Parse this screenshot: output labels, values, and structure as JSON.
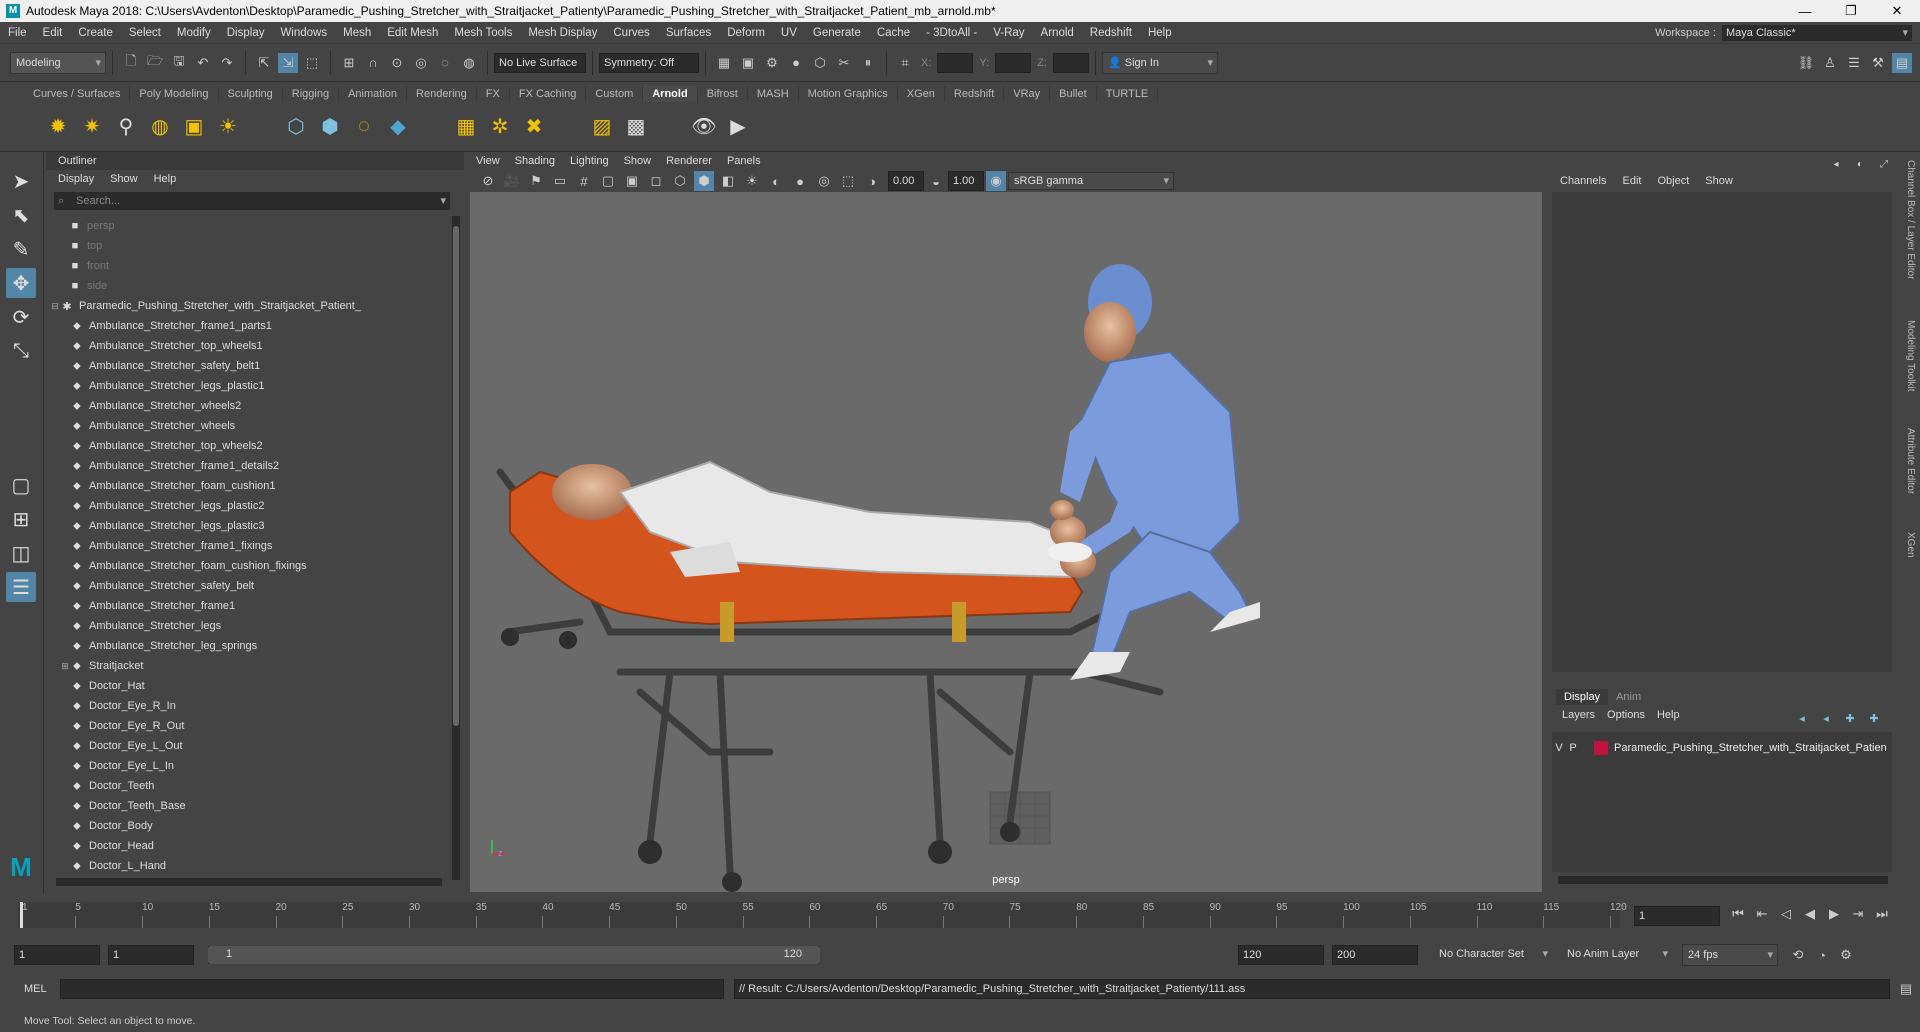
{
  "window": {
    "title": "Autodesk Maya 2018: C:\\Users\\Avdenton\\Desktop\\Paramedic_Pushing_Stretcher_with_Straitjacket_Patienty\\Paramedic_Pushing_Stretcher_with_Straitjacket_Patient_mb_arnold.mb*",
    "logo": "M"
  },
  "menubar": [
    "File",
    "Edit",
    "Create",
    "Select",
    "Modify",
    "Display",
    "Windows",
    "Mesh",
    "Edit Mesh",
    "Mesh Tools",
    "Mesh Display",
    "Curves",
    "Surfaces",
    "Deform",
    "UV",
    "Generate",
    "Cache",
    "- 3DtoAll -",
    "V-Ray",
    "Arnold",
    "Redshift",
    "Help"
  ],
  "workspace": {
    "label": "Workspace :",
    "value": "Maya Classic*"
  },
  "statusline": {
    "mode": "Modeling",
    "live_surface": "No Live Surface",
    "symmetry": "Symmetry: Off",
    "x_label": "X:",
    "y_label": "Y:",
    "z_label": "Z:",
    "sign_in": "Sign In"
  },
  "shelf_tabs": [
    "Curves / Surfaces",
    "Poly Modeling",
    "Sculpting",
    "Rigging",
    "Animation",
    "Rendering",
    "FX",
    "FX Caching",
    "Custom",
    "Arnold",
    "Bifrost",
    "MASH",
    "Motion Graphics",
    "XGen",
    "Redshift",
    "VRay",
    "Bullet",
    "TURTLE"
  ],
  "shelf_active": "Arnold",
  "outliner": {
    "title": "Outliner",
    "menu": [
      "Display",
      "Show",
      "Help"
    ],
    "search_placeholder": "Search...",
    "cameras": [
      "persp",
      "top",
      "front",
      "side"
    ],
    "group": "Paramedic_Pushing_Stretcher_with_Straitjacket_Patient_",
    "children": [
      "Ambulance_Stretcher_frame1_parts1",
      "Ambulance_Stretcher_top_wheels1",
      "Ambulance_Stretcher_safety_belt1",
      "Ambulance_Stretcher_legs_plastic1",
      "Ambulance_Stretcher_wheels2",
      "Ambulance_Stretcher_wheels",
      "Ambulance_Stretcher_top_wheels2",
      "Ambulance_Stretcher_frame1_details2",
      "Ambulance_Stretcher_foam_cushion1",
      "Ambulance_Stretcher_legs_plastic2",
      "Ambulance_Stretcher_legs_plastic3",
      "Ambulance_Stretcher_frame1_fixings",
      "Ambulance_Stretcher_foam_cushion_fixings",
      "Ambulance_Stretcher_safety_belt",
      "Ambulance_Stretcher_frame1",
      "Ambulance_Stretcher_legs",
      "Ambulance_Stretcher_leg_springs",
      "Straitjacket",
      "Doctor_Hat",
      "Doctor_Eye_R_In",
      "Doctor_Eye_R_Out",
      "Doctor_Eye_L_Out",
      "Doctor_Eye_L_In",
      "Doctor_Teeth",
      "Doctor_Teeth_Base",
      "Doctor_Body",
      "Doctor_Head",
      "Doctor_L_Hand"
    ]
  },
  "viewport": {
    "menu": [
      "View",
      "Shading",
      "Lighting",
      "Show",
      "Renderer",
      "Panels"
    ],
    "exposure": "0.00",
    "gamma": "1.00",
    "color_space": "sRGB gamma",
    "camera_label": "persp"
  },
  "channelbox": {
    "menu": [
      "Channels",
      "Edit",
      "Object",
      "Show"
    ],
    "layer_tabs": [
      "Display",
      "Anim"
    ],
    "layer_menu": [
      "Layers",
      "Options",
      "Help"
    ],
    "layer": {
      "v": "V",
      "p": "P",
      "name": "Paramedic_Pushing_Stretcher_with_Straitjacket_Patien",
      "color": "#c0143c"
    }
  },
  "side_tabs": [
    "Channel Box / Layer Editor",
    "Modeling Toolkit",
    "Attribute Editor",
    "XGen"
  ],
  "timeline": {
    "ticks": [
      "1",
      "5",
      "10",
      "15",
      "20",
      "25",
      "30",
      "35",
      "40",
      "45",
      "50",
      "55",
      "60",
      "65",
      "70",
      "75",
      "80",
      "85",
      "90",
      "95",
      "100",
      "105",
      "110",
      "115",
      "120"
    ],
    "current_frame": "1"
  },
  "range": {
    "start": "1",
    "anim_start": "1",
    "range_start": "1",
    "range_end": "120",
    "anim_end": "120",
    "end": "200",
    "character_set": "No Character Set",
    "anim_layer": "No Anim Layer",
    "fps": "24 fps"
  },
  "cmdline": {
    "lang": "MEL",
    "result": "// Result: C:/Users/Avdenton/Desktop/Paramedic_Pushing_Stretcher_with_Straitjacket_Patienty/111.ass"
  },
  "helpline": "Move Tool: Select an object to move."
}
